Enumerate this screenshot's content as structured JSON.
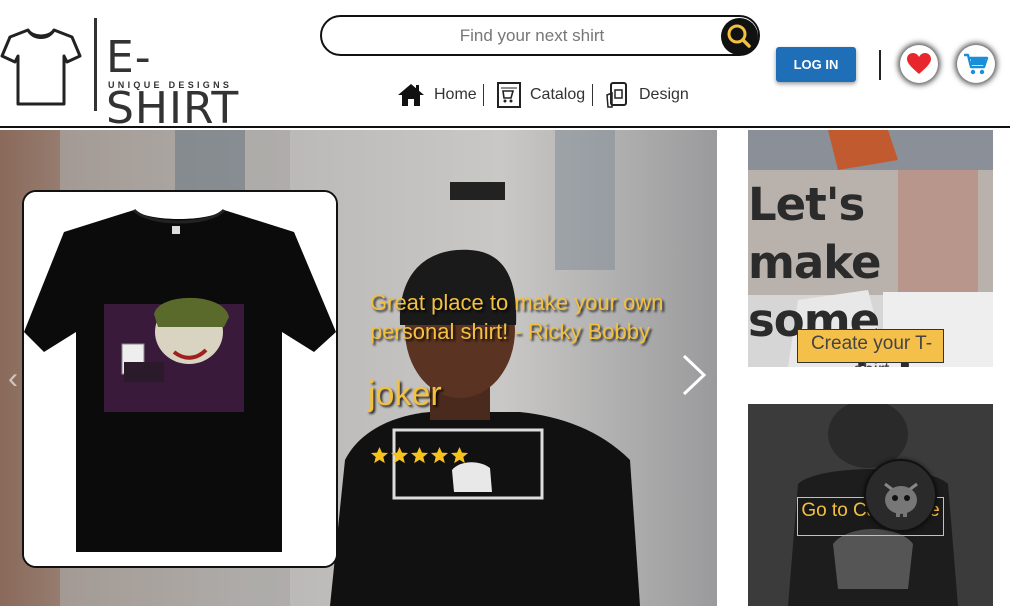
{
  "brand": {
    "name": "E-SHIRT",
    "tagline": "UNIQUE DESIGNS"
  },
  "search": {
    "placeholder": "Find your next shirt",
    "icon": "search-icon"
  },
  "nav": {
    "items": [
      {
        "label": "Home",
        "icon": "home-icon"
      },
      {
        "label": "Catalog",
        "icon": "catalog-icon"
      },
      {
        "label": "Design",
        "icon": "design-icon"
      }
    ]
  },
  "header_actions": {
    "login_label": "LOG IN",
    "favorites_icon": "heart-icon",
    "cart_icon": "cart-icon"
  },
  "hero": {
    "quote": "Great place to make your own personal shirt! - Ricky Bobby",
    "product_name": "joker",
    "rating": 5,
    "rating_max": 5
  },
  "promo": {
    "make_magic_title": "Let's make some magic!",
    "create_label": "Create your T-shirt",
    "catalogue_label": "Go to Catalogue"
  },
  "colors": {
    "accent": "#f3c040",
    "login": "#1f6fb8",
    "heart": "#e8262d",
    "cart": "#1a8fd8"
  }
}
